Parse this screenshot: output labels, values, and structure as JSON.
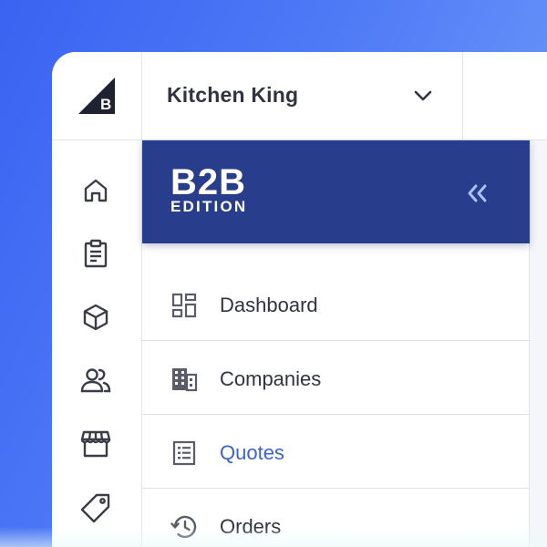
{
  "store": {
    "name": "Kitchen King"
  },
  "b2b": {
    "logo_top": "B2B",
    "logo_bottom": "EDITION"
  },
  "rail": {
    "logo_icon": "bigcommerce-logo-icon",
    "items": [
      {
        "icon": "home-icon"
      },
      {
        "icon": "clipboard-icon"
      },
      {
        "icon": "box-icon"
      },
      {
        "icon": "users-icon"
      },
      {
        "icon": "storefront-icon"
      },
      {
        "icon": "tag-icon"
      }
    ]
  },
  "menu": {
    "items": [
      {
        "label": "Dashboard",
        "icon": "dashboard-icon"
      },
      {
        "label": "Companies",
        "icon": "building-icon"
      },
      {
        "label": "Quotes",
        "icon": "quote-list-icon",
        "active": true
      },
      {
        "label": "Orders",
        "icon": "history-icon"
      }
    ]
  },
  "colors": {
    "banner": "#283d8c",
    "active": "#3c64c8",
    "text": "#313440",
    "icon": "#3a3d47"
  }
}
